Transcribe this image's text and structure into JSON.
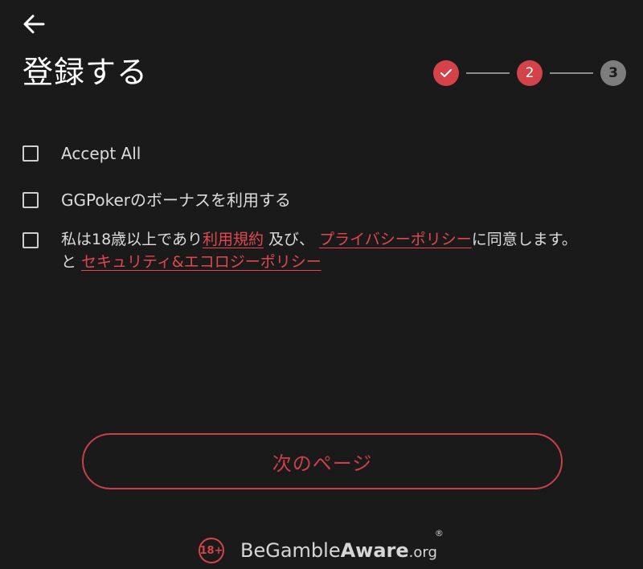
{
  "header": {
    "title": "登録する"
  },
  "stepper": {
    "steps": [
      {
        "label": "✓",
        "state": "done"
      },
      {
        "label": "2",
        "state": "active"
      },
      {
        "label": "3",
        "state": "pending"
      }
    ]
  },
  "options": {
    "accept_all": "Accept All",
    "bonus": "GGPokerのボーナスを利用する",
    "terms": {
      "prefix": "私は18歳以上であり",
      "terms_link": "利用規約",
      "middle": " 及び、 ",
      "privacy_link": "プライバシーポリシー",
      "suffix": "に同意します。",
      "line2_prefix": "と ",
      "security_link": "セキュリティ&エコロジーポリシー"
    }
  },
  "actions": {
    "next_label": "次のページ"
  },
  "footer": {
    "age_badge": "18+",
    "brand_be": "Be",
    "brand_gamble": "Gamble",
    "brand_aware": "Aware",
    "brand_org": ".org",
    "registered": "®"
  },
  "colors": {
    "accent": "#d4424a",
    "background": "#1b1a1b",
    "pending": "#7d7d7d"
  }
}
